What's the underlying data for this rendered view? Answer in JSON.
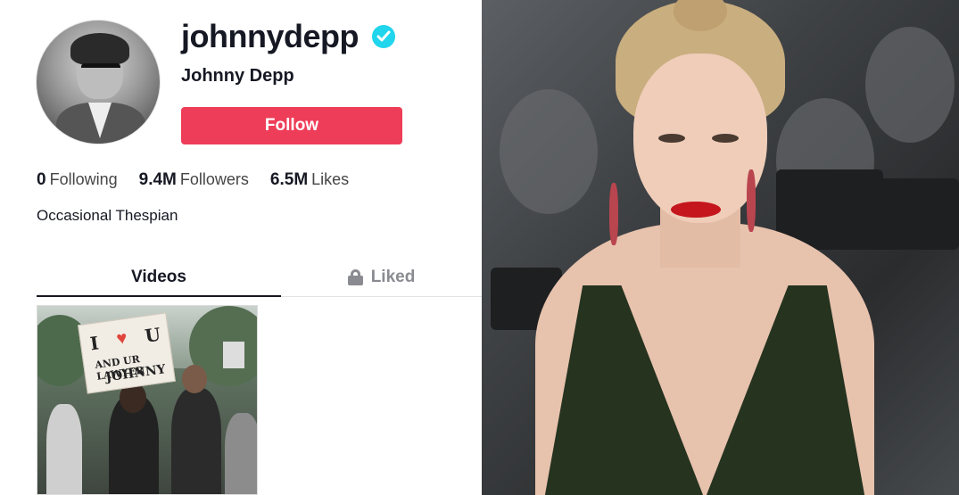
{
  "profile": {
    "username": "johnnydepp",
    "display_name": "Johnny Depp",
    "verified": true,
    "follow_label": "Follow",
    "bio": "Occasional Thespian"
  },
  "stats": [
    {
      "value": "0",
      "label": "Following"
    },
    {
      "value": "9.4M",
      "label": "Followers"
    },
    {
      "value": "6.5M",
      "label": "Likes"
    }
  ],
  "tabs": [
    {
      "label": "Videos",
      "active": true,
      "icon": null
    },
    {
      "label": "Liked",
      "active": false,
      "icon": "lock-icon"
    }
  ],
  "video_sign": {
    "line1_left": "I",
    "line1_right": "U",
    "line2": "AND UR LAWYER",
    "line3": "JOHNNY"
  },
  "colors": {
    "follow_button": "#ee3d58",
    "verified_badge": "#20d5ec",
    "text_primary": "#161823",
    "text_muted": "#8a8b91"
  }
}
